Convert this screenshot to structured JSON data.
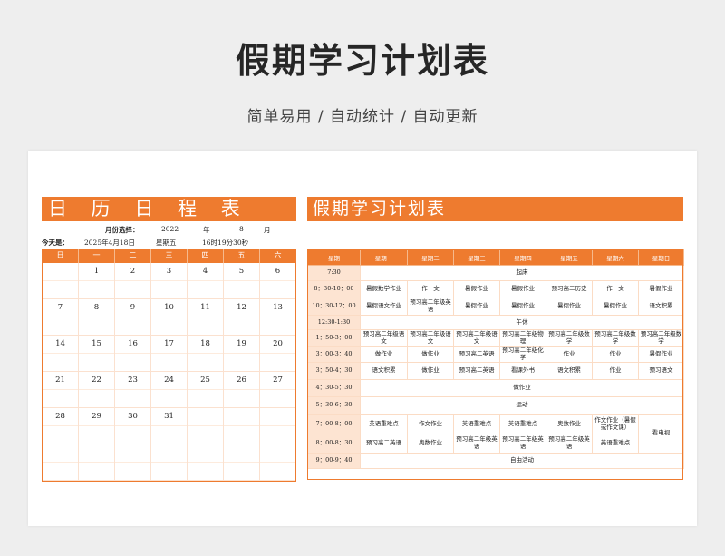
{
  "title": "假期学习计划表",
  "subtitle": "简单易用 / 自动统计 / 自动更新",
  "calendar": {
    "title": "日 历 日 程 表",
    "month_label": "月份选择：",
    "year": "2022",
    "year_unit": "年",
    "month": "8",
    "month_unit": "月",
    "today_label": "今天是：",
    "today_date": "2025年4月18日",
    "today_weekday": "星期五",
    "today_time": "16时19分30秒",
    "weekdays": [
      "日",
      "一",
      "二",
      "三",
      "四",
      "五",
      "六"
    ],
    "weeks": [
      [
        "",
        "1",
        "2",
        "3",
        "4",
        "5",
        "6"
      ],
      [
        "7",
        "8",
        "9",
        "10",
        "11",
        "12",
        "13"
      ],
      [
        "14",
        "15",
        "16",
        "17",
        "18",
        "19",
        "20"
      ],
      [
        "21",
        "22",
        "23",
        "24",
        "25",
        "26",
        "27"
      ],
      [
        "28",
        "29",
        "30",
        "31",
        "",
        "",
        ""
      ],
      [
        "",
        "",
        "",
        "",
        "",
        "",
        ""
      ]
    ]
  },
  "plan": {
    "title": "假期学习计划表",
    "headers": [
      "星期",
      "星期一",
      "星期二",
      "星期三",
      "星期四",
      "星期五",
      "星期六",
      "星期日"
    ],
    "rows": [
      {
        "time": "7:30",
        "merged": "起床"
      },
      {
        "time": "8：30-10：00",
        "cells": [
          "暑假数学作业",
          "作　文",
          "暑假作业",
          "暑假作业",
          "预习高二历史",
          "作　文",
          "暑假作业"
        ]
      },
      {
        "time": "10：30-12：00",
        "cells": [
          "暑假语文作业",
          "预习高二年级英语",
          "暑假作业",
          "暑假作业",
          "暑假作业",
          "暑假作业",
          "语文积累"
        ]
      },
      {
        "time": "12:30-1:30",
        "merged": "午休"
      },
      {
        "time": "1：50-3：00",
        "cells": [
          "预习高二年级语文",
          "预习高二年级语文",
          "预习高二年级语文",
          "预习高二年级物理",
          "预习高二年级数学",
          "预习高二年级数学",
          "预习高二年级数学"
        ]
      },
      {
        "time": "3：00-3：40",
        "cells": [
          "做作业",
          "做作业",
          "预习高二英语",
          "预习高二年级化学",
          "作业",
          "作业",
          "暑假作业"
        ]
      },
      {
        "time": "3：50-4：30",
        "cells": [
          "语文积累",
          "做作业",
          "预习高二英语",
          "看课外书",
          "语文积累",
          "作业",
          "预习语文"
        ]
      },
      {
        "time": "4：30-5：30",
        "merged": "做作业"
      },
      {
        "time": "5：30-6：30",
        "merged": "运动"
      },
      {
        "time": "7：00-8：00",
        "cells": [
          "英语重难点",
          "作文作业",
          "英语重难点",
          "英语重难点",
          "奥数作业",
          "作文作业（暑假或作文课）"
        ],
        "sunday": "看电视"
      },
      {
        "time": "8：00-8：30",
        "cells": [
          "预习高二英语",
          "奥数作业",
          "预习高二年级英语",
          "预习高二年级英语",
          "预习高二年级英语",
          "英语重难点"
        ]
      },
      {
        "time": "9：00-9：40",
        "merged": "自由活动"
      }
    ]
  }
}
